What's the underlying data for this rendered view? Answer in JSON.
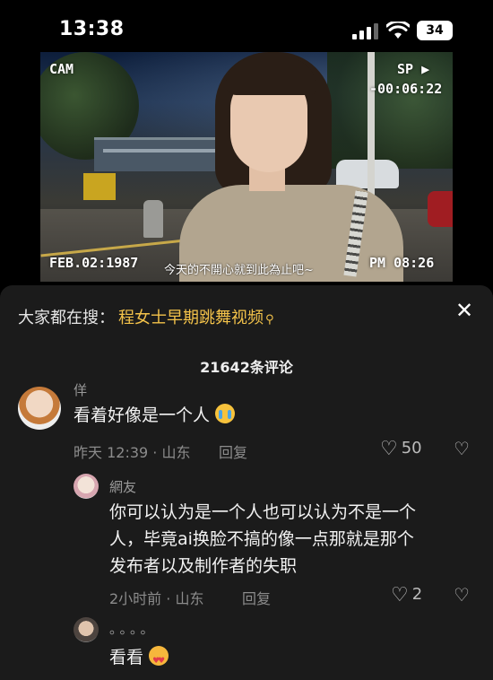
{
  "status_bar": {
    "time": "13:38",
    "battery": "34",
    "icons": [
      "signal-icon",
      "wifi-icon",
      "battery-icon"
    ]
  },
  "video": {
    "cam_label": "CAM",
    "sp_label": "SP ▶",
    "counter": "-00:06:22",
    "date": "FEB.02:1987",
    "clock": "PM 08:26",
    "subtitle": "今天的不開心就到此為止吧~"
  },
  "search": {
    "prefix": "大家都在搜：",
    "term": "程女士早期跳舞视频",
    "term_icon": "search-icon"
  },
  "comment_count": "21642条评论",
  "comments": [
    {
      "name": "佯",
      "text": "看着好像是一个人",
      "emoji": "crying-face-icon",
      "meta": "昨天 12:39 · 山东",
      "reply": "回复",
      "likes": "50"
    },
    {
      "name": "網友",
      "text": "你可以认为是一个人也可以认为不是一个人，毕竟ai换脸不搞的像一点那就是那个发布者以及制作者的失职",
      "line1": "你可以认为是一个人也可以认为不是一个",
      "line2": "人，毕竟ai换脸不搞的像一点那就是那个",
      "line3": "发布者以及制作者的失职",
      "meta": "2小时前 · 山东",
      "reply": "回复",
      "likes": "2"
    },
    {
      "name": "。。。。",
      "text": "看看",
      "emoji": "heart-eyes-face-icon"
    }
  ],
  "colors": {
    "panel_bg": "#1b1b1b",
    "search_term": "#f3c24a",
    "meta_text": "#8c8c8c"
  }
}
